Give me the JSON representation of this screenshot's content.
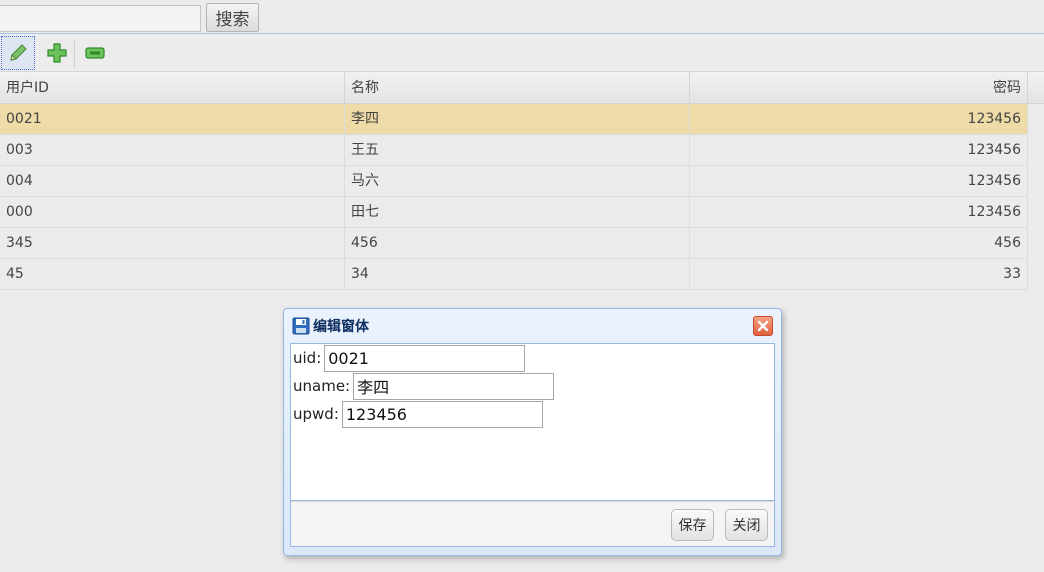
{
  "search": {
    "value": "",
    "button_label": "搜索"
  },
  "toolbar": {
    "icons": [
      "pencil-edit-icon",
      "plus-add-icon",
      "minus-remove-icon"
    ],
    "accent": "#5aa94c"
  },
  "grid": {
    "columns": [
      "用户ID",
      "名称",
      "密码"
    ],
    "rows": [
      [
        "0021",
        "李四",
        "123456"
      ],
      [
        "003",
        "王五",
        "123456"
      ],
      [
        "004",
        "马六",
        "123456"
      ],
      [
        "000",
        "田七",
        "123456"
      ],
      [
        "345",
        "456",
        "456"
      ],
      [
        "45",
        "34",
        "33"
      ]
    ],
    "selected_row": 0,
    "selected_color": "#efdba7"
  },
  "dialog": {
    "title": "编辑窗体",
    "title_icon": "floppy-disk-save-icon",
    "fields": [
      {
        "label": "uid:",
        "value": "0021"
      },
      {
        "label": "uname:",
        "value": "李四"
      },
      {
        "label": "upwd:",
        "value": "123456"
      }
    ],
    "save_label": "保存",
    "close_label": "关闭"
  }
}
